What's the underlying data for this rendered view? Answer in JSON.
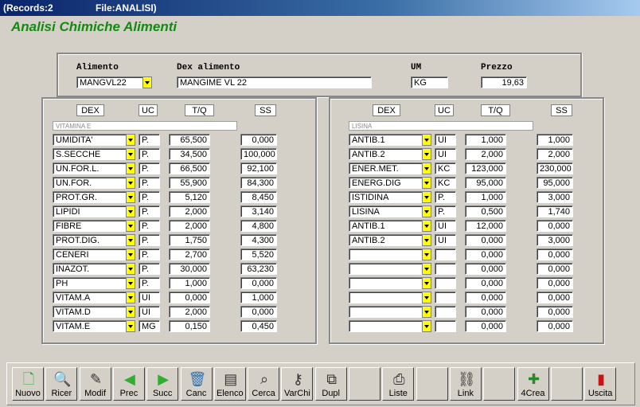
{
  "titlebar": {
    "records": "(Records:2",
    "file": "File:ANALISI)"
  },
  "app_title": "Analisi Chimiche Alimenti",
  "header": {
    "alimento_label": "Alimento",
    "alimento_value": "MANGVL22",
    "dex_label": "Dex alimento",
    "dex_value": "MANGIME VL 22",
    "um_label": "UM",
    "um_value": "KG",
    "prezzo_label": "Prezzo",
    "prezzo_value": "19,63"
  },
  "columns": {
    "dex": "DEX",
    "uc": "UC",
    "tq": "T/Q",
    "ss": "SS"
  },
  "left": {
    "subtitle": "VITAMINA E",
    "rows": [
      {
        "dex": "UMIDITA'",
        "uc": "P.",
        "tq": "65,500",
        "ss": "0,000"
      },
      {
        "dex": "S.SECCHE",
        "uc": "P.",
        "tq": "34,500",
        "ss": "100,000"
      },
      {
        "dex": "UN.FOR.L.",
        "uc": "P.",
        "tq": "66,500",
        "ss": "92,100"
      },
      {
        "dex": "UN.FOR.",
        "uc": "P.",
        "tq": "55,900",
        "ss": "84,300"
      },
      {
        "dex": "PROT.GR.",
        "uc": "P.",
        "tq": "5,120",
        "ss": "8,450"
      },
      {
        "dex": "LIPIDI",
        "uc": "P.",
        "tq": "2,000",
        "ss": "3,140"
      },
      {
        "dex": "FIBRE",
        "uc": "P.",
        "tq": "2,000",
        "ss": "4,800"
      },
      {
        "dex": "PROT.DIG.",
        "uc": "P.",
        "tq": "1,750",
        "ss": "4,300"
      },
      {
        "dex": "CENERI",
        "uc": "P.",
        "tq": "2,700",
        "ss": "5,520"
      },
      {
        "dex": "INAZOT.",
        "uc": "P.",
        "tq": "30,000",
        "ss": "63,230"
      },
      {
        "dex": "PH",
        "uc": "P.",
        "tq": "1,000",
        "ss": "0,000"
      },
      {
        "dex": "VITAM.A",
        "uc": "UI",
        "tq": "0,000",
        "ss": "1,000"
      },
      {
        "dex": "VITAM.D",
        "uc": "UI",
        "tq": "2,000",
        "ss": "0,000"
      },
      {
        "dex": "VITAM.E",
        "uc": "MG",
        "tq": "0,150",
        "ss": "0,450"
      }
    ]
  },
  "right": {
    "subtitle": "LISINA",
    "rows": [
      {
        "dex": "ANTIB.1",
        "uc": "UI",
        "tq": "1,000",
        "ss": "1,000"
      },
      {
        "dex": "ANTIB.2",
        "uc": "UI",
        "tq": "2,000",
        "ss": "2,000"
      },
      {
        "dex": "ENER.MET.",
        "uc": "KC",
        "tq": "123,000",
        "ss": "230,000"
      },
      {
        "dex": "ENERG.DIG",
        "uc": "KC",
        "tq": "95,000",
        "ss": "95,000"
      },
      {
        "dex": "ISTIDINA",
        "uc": "P.",
        "tq": "1,000",
        "ss": "3,000"
      },
      {
        "dex": "LISINA",
        "uc": "P.",
        "tq": "0,500",
        "ss": "1,740"
      },
      {
        "dex": "ANTIB.1",
        "uc": "UI",
        "tq": "12,000",
        "ss": "0,000"
      },
      {
        "dex": "ANTIB.2",
        "uc": "UI",
        "tq": "0,000",
        "ss": "3,000"
      },
      {
        "dex": "",
        "uc": "",
        "tq": "0,000",
        "ss": "0,000"
      },
      {
        "dex": "",
        "uc": "",
        "tq": "0,000",
        "ss": "0,000"
      },
      {
        "dex": "",
        "uc": "",
        "tq": "0,000",
        "ss": "0,000"
      },
      {
        "dex": "",
        "uc": "",
        "tq": "0,000",
        "ss": "0,000"
      },
      {
        "dex": "",
        "uc": "",
        "tq": "0,000",
        "ss": "0,000"
      },
      {
        "dex": "",
        "uc": "",
        "tq": "0,000",
        "ss": "0,000"
      }
    ]
  },
  "toolbar": [
    {
      "label": "Nuovo",
      "icon": "new-doc-icon"
    },
    {
      "label": "Ricer",
      "icon": "search-icon"
    },
    {
      "label": "Modif",
      "icon": "edit-icon"
    },
    {
      "label": "Prec",
      "icon": "arrow-left-icon"
    },
    {
      "label": "Succ",
      "icon": "arrow-right-icon"
    },
    {
      "label": "Canc",
      "icon": "trash-icon"
    },
    {
      "label": "Elenco",
      "icon": "list-icon"
    },
    {
      "label": "Cerca",
      "icon": "find-icon"
    },
    {
      "label": "VarChi",
      "icon": "keys-icon"
    },
    {
      "label": "Dupl",
      "icon": "copy-icon"
    },
    {
      "label": "",
      "icon": ""
    },
    {
      "label": "Liste",
      "icon": "printer-icon"
    },
    {
      "label": "",
      "icon": ""
    },
    {
      "label": "Link",
      "icon": "link-icon"
    },
    {
      "label": "",
      "icon": ""
    },
    {
      "label": "4Crea",
      "icon": "create-icon"
    },
    {
      "label": "",
      "icon": ""
    },
    {
      "label": "Uscita",
      "icon": "exit-door-icon"
    }
  ]
}
